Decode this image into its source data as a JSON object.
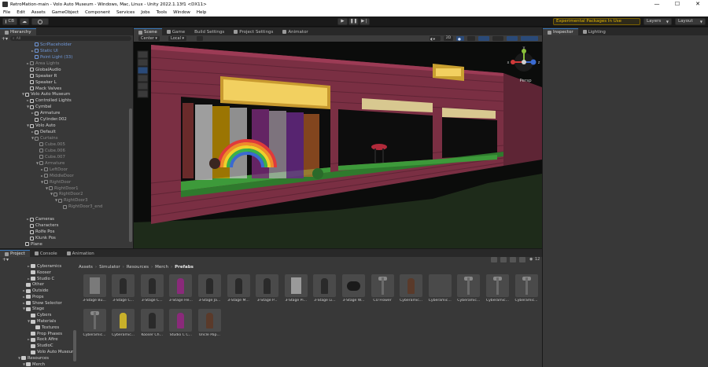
{
  "window": {
    "title": "RetroMation-main - Volo Auto Museum - Windows, Mac, Linux - Unity 2022.1.13f1 <DX11>",
    "controls": [
      "—",
      "☐",
      "✕"
    ]
  },
  "menu": [
    "File",
    "Edit",
    "Assets",
    "GameObject",
    "Component",
    "Services",
    "Jobs",
    "Tools",
    "Window",
    "Help"
  ],
  "toolbar": {
    "account": "CB",
    "experimental": "Experimental Packages In Use",
    "layers": "Layers",
    "layout": "Layout"
  },
  "tabs": {
    "hierarchy": "Hierarchy",
    "scene": "Scene",
    "game": "Game",
    "build_settings": "Build Settings",
    "project_settings": "Project Settings",
    "animator": "Animator",
    "inspector": "Inspector",
    "lighting": "Lighting",
    "project": "Project",
    "console": "Console",
    "animation": "Animation"
  },
  "hierarchy": {
    "search_value": "All",
    "items": [
      {
        "depth": 2,
        "arrow": "",
        "label": "ScrPlaceholder",
        "tone": "blue"
      },
      {
        "depth": 2,
        "arrow": "►",
        "label": "Static UI",
        "tone": "blue"
      },
      {
        "depth": 2,
        "arrow": "",
        "label": "Point Light (33)",
        "tone": "blue"
      },
      {
        "depth": 1,
        "arrow": "►",
        "label": "Area Lights",
        "tone": "dim"
      },
      {
        "depth": 1,
        "arrow": "",
        "label": "GlobalAudio",
        "tone": ""
      },
      {
        "depth": 1,
        "arrow": "",
        "label": "Speaker R",
        "tone": ""
      },
      {
        "depth": 1,
        "arrow": "",
        "label": "Speaker L",
        "tone": ""
      },
      {
        "depth": 1,
        "arrow": "",
        "label": "Mack Valves",
        "tone": ""
      },
      {
        "depth": 0,
        "arrow": "▼",
        "label": "Volo Auto Museum",
        "tone": ""
      },
      {
        "depth": 1,
        "arrow": "►",
        "label": "Controlled Lights",
        "tone": ""
      },
      {
        "depth": 1,
        "arrow": "▼",
        "label": "Cymbal",
        "tone": ""
      },
      {
        "depth": 2,
        "arrow": "►",
        "label": "Armature",
        "tone": ""
      },
      {
        "depth": 2,
        "arrow": "",
        "label": "Cylinder.002",
        "tone": ""
      },
      {
        "depth": 1,
        "arrow": "▼",
        "label": "Volo Auto",
        "tone": ""
      },
      {
        "depth": 2,
        "arrow": "►",
        "label": "Default",
        "tone": ""
      },
      {
        "depth": 2,
        "arrow": "▼",
        "label": "Curtains",
        "tone": "dim"
      },
      {
        "depth": 3,
        "arrow": "",
        "label": "Cube.005",
        "tone": "dim"
      },
      {
        "depth": 3,
        "arrow": "",
        "label": "Cube.006",
        "tone": "dim"
      },
      {
        "depth": 3,
        "arrow": "",
        "label": "Cube.007",
        "tone": "dim"
      },
      {
        "depth": 3,
        "arrow": "▼",
        "label": "Armature",
        "tone": "dim"
      },
      {
        "depth": 4,
        "arrow": "►",
        "label": "LeftDoor",
        "tone": "dim"
      },
      {
        "depth": 4,
        "arrow": "►",
        "label": "MiddleDoor",
        "tone": "dim"
      },
      {
        "depth": 4,
        "arrow": "▼",
        "label": "RightDoor",
        "tone": "dim"
      },
      {
        "depth": 5,
        "arrow": "▼",
        "label": "RightDoor1",
        "tone": "dim"
      },
      {
        "depth": 6,
        "arrow": "▼",
        "label": "RightDoor2",
        "tone": "dim"
      },
      {
        "depth": 7,
        "arrow": "▼",
        "label": "RightDoor3",
        "tone": "dim"
      },
      {
        "depth": 8,
        "arrow": "",
        "label": "RightDoor3_end",
        "tone": "dim"
      },
      {
        "depth": 0,
        "arrow": "",
        "label": "",
        "tone": ""
      },
      {
        "depth": 1,
        "arrow": "►",
        "label": "Cameras",
        "tone": ""
      },
      {
        "depth": 1,
        "arrow": "",
        "label": "Characters",
        "tone": ""
      },
      {
        "depth": 1,
        "arrow": "",
        "label": "Rolfe Pos",
        "tone": ""
      },
      {
        "depth": 1,
        "arrow": "",
        "label": "Klunk Pos",
        "tone": ""
      },
      {
        "depth": 0,
        "arrow": "",
        "label": "Plane",
        "tone": ""
      },
      {
        "depth": 0,
        "arrow": "",
        "label": "Directional Light (1)",
        "tone": ""
      },
      {
        "depth": 0,
        "arrow": "",
        "label": "GlobalAmbience",
        "tone": ""
      },
      {
        "depth": 0,
        "arrow": "",
        "label": "Plane (1)",
        "tone": ""
      }
    ]
  },
  "scene": {
    "pivot": "Center",
    "space": "Local",
    "mode_2d": "2D",
    "gizmo_label": "Persp",
    "gizmo_axes": {
      "y": "y",
      "x": "x",
      "z": "z"
    }
  },
  "project": {
    "badge": "12",
    "breadcrumb": [
      "Assets",
      "Simulator",
      "Resources",
      "Merch",
      "Prefabs"
    ],
    "tree": [
      {
        "depth": 2,
        "arrow": "►",
        "label": "Cyberamics"
      },
      {
        "depth": 2,
        "arrow": "",
        "label": "Kooser"
      },
      {
        "depth": 2,
        "arrow": "►",
        "label": "Studio C"
      },
      {
        "depth": 1,
        "arrow": "",
        "label": "Other"
      },
      {
        "depth": 1,
        "arrow": "►",
        "label": "Outside"
      },
      {
        "depth": 1,
        "arrow": "►",
        "label": "Props"
      },
      {
        "depth": 1,
        "arrow": "►",
        "label": "Show Selector"
      },
      {
        "depth": 1,
        "arrow": "▼",
        "label": "Stage"
      },
      {
        "depth": 2,
        "arrow": "",
        "label": "Cybers"
      },
      {
        "depth": 2,
        "arrow": "▼",
        "label": "Materials"
      },
      {
        "depth": 3,
        "arrow": "",
        "label": "Textures"
      },
      {
        "depth": 2,
        "arrow": "",
        "label": "Prop Phases"
      },
      {
        "depth": 2,
        "arrow": "►",
        "label": "Rock Afire"
      },
      {
        "depth": 2,
        "arrow": "",
        "label": "StudioC"
      },
      {
        "depth": 2,
        "arrow": "",
        "label": "Volo Auto Museum"
      },
      {
        "depth": 0,
        "arrow": "▼",
        "label": "Resources"
      },
      {
        "depth": 1,
        "arrow": "▼",
        "label": "Merch"
      },
      {
        "depth": 2,
        "arrow": "",
        "label": "Icons"
      }
    ],
    "assets": [
      {
        "label": "3-Stage Bu...",
        "shape": "panel"
      },
      {
        "label": "3-Stage C...",
        "shape": "figure"
      },
      {
        "label": "3-Stage C...",
        "shape": "figure"
      },
      {
        "label": "3-Stage He...",
        "shape": "figure-pink"
      },
      {
        "label": "3-Stage Ja...",
        "shape": "figure"
      },
      {
        "label": "3-Stage M...",
        "shape": "figure"
      },
      {
        "label": "3-Stage P...",
        "shape": "figure"
      },
      {
        "label": "3-Stage Pi...",
        "shape": "box"
      },
      {
        "label": "3-Stage Li...",
        "shape": "figure"
      },
      {
        "label": "3-Stage W...",
        "shape": "dark"
      },
      {
        "label": "CU Flower",
        "shape": "stand"
      },
      {
        "label": "Cyberamic...",
        "shape": "figure-brown"
      },
      {
        "label": "Cyberamic...",
        "shape": "blank"
      },
      {
        "label": "Cyberamic...",
        "shape": "stand"
      },
      {
        "label": "Cyberamic...",
        "shape": "stand"
      },
      {
        "label": "Cyberamic...",
        "shape": "stand"
      },
      {
        "label": "Cyberamic...",
        "shape": "stand"
      },
      {
        "label": "Cyberamic...",
        "shape": "figure-yellow"
      },
      {
        "label": "Kooser Ch...",
        "shape": "figure"
      },
      {
        "label": "Studio C C...",
        "shape": "figure-pink"
      },
      {
        "label": "Uncle Pap...",
        "shape": "figure-brown"
      }
    ]
  },
  "colors": {
    "accent": "#3a79bb",
    "warning": "#e6b800",
    "panel": "#383838",
    "wall": "#a83a55",
    "floor": "#3d9a3a"
  }
}
